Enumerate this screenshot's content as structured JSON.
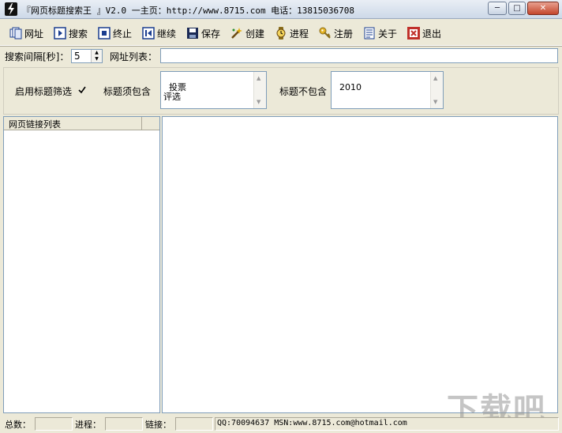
{
  "window": {
    "title": "『网页标题搜索王 』V2.0  一主页：http://www.8715.com 电话：13815036708",
    "minimize_glyph": "─",
    "maximize_glyph": "□",
    "close_glyph": "✕"
  },
  "toolbar": {
    "url_label": "网址",
    "search_label": "搜索",
    "stop_label": "终止",
    "continue_label": "继续",
    "save_label": "保存",
    "create_label": "创建",
    "progress_label": "进程",
    "register_label": "注册",
    "about_label": "关于",
    "exit_label": "退出"
  },
  "search": {
    "interval_label": "搜索间隔[秒]：",
    "interval_value": "5",
    "url_list_label": "网址列表：",
    "url_list_value": ""
  },
  "filter": {
    "enable_label": "启用标题筛选",
    "enabled": true,
    "include_label": "标题须包含",
    "include_text": "投票\n评选",
    "exclude_label": "标题不包含",
    "exclude_text": "2010"
  },
  "links_list": {
    "header": "网页链接列表"
  },
  "status": {
    "total_label": "总数：",
    "total_value": "",
    "progress_label": "进程：",
    "progress_value": "",
    "links_label": "链接：",
    "links_value": "",
    "contact": "QQ:70094637 MSN:www.8715.com@hotmail.com"
  },
  "watermark": "下载吧",
  "colors": {
    "window_face": "#ece9d8",
    "field_border": "#7f9db9",
    "icon_blue": "#1a3d8f",
    "icon_red": "#c0302a"
  }
}
